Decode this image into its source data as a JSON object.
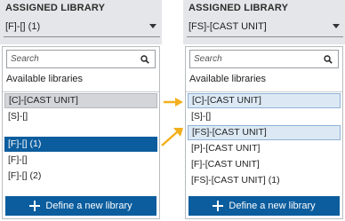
{
  "colors": {
    "accent": "#0b5d9e",
    "arrow": "#f2b01e",
    "header_bg": "#e4e6e9",
    "highlight_bg": "#dce9f5",
    "hover_bg": "#d3d5d8"
  },
  "left": {
    "section_title": "ASSIGNED LIBRARY",
    "selected_value": "[F]-[] (1)",
    "search_placeholder": "Search",
    "available_label": "Available libraries",
    "items": [
      "[C]-[CAST UNIT]",
      "[S]-[]",
      "[F]-[] (1)",
      "[F]-[]",
      "[F]-[] (2)"
    ],
    "define_button": "Define a new library"
  },
  "right": {
    "section_title": "ASSIGNED LIBRARY",
    "selected_value": "[FS]-[CAST UNIT]",
    "search_placeholder": "Search",
    "available_label": "Available libraries",
    "items": [
      "[C]-[CAST UNIT]",
      "[S]-[]",
      "[FS]-[CAST UNIT]",
      "[P]-[CAST UNIT]",
      "[F]-[CAST UNIT]",
      "[FS]-[CAST UNIT] (1)"
    ],
    "define_button": "Define a new library"
  },
  "icons": {
    "search": "search-icon",
    "dropdown": "chevron-down-icon",
    "add": "plus-icon",
    "callout": "arrow-right-icon"
  }
}
